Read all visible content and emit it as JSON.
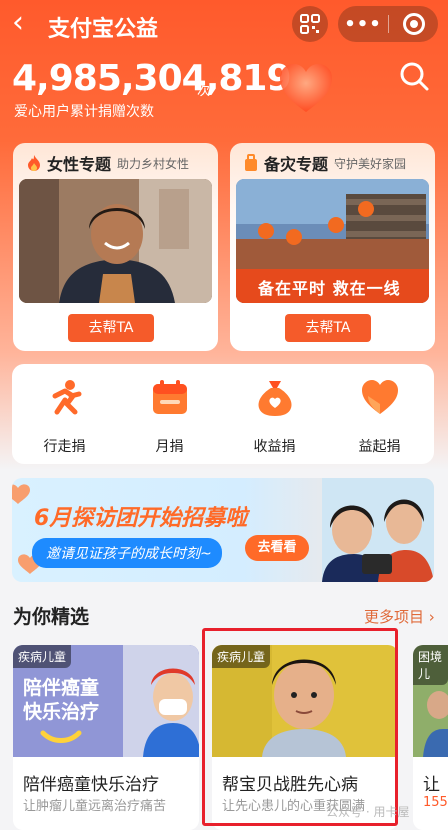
{
  "app": {
    "title": "支付宝公益"
  },
  "stats": {
    "count": "4,985,304,819",
    "unit": "次",
    "label": "爱心用户累计捐赠次数"
  },
  "topics": [
    {
      "title": "女性专题",
      "subtitle": "助力乡村女性",
      "button": "去帮TA"
    },
    {
      "title": "备灾专题",
      "subtitle": "守护美好家园",
      "button": "去帮TA",
      "image_text": "备在平时 救在一线"
    }
  ],
  "quick_actions": [
    {
      "label": "行走捐",
      "icon": "running-icon"
    },
    {
      "label": "月捐",
      "icon": "calendar-icon"
    },
    {
      "label": "收益捐",
      "icon": "money-bag-icon"
    },
    {
      "label": "益起捐",
      "icon": "heart-icon"
    }
  ],
  "banner": {
    "title": "6月探访团开始招募啦",
    "subtitle": "邀请见证孩子的成长时刻~",
    "button": "去看看"
  },
  "section": {
    "title": "为你精选",
    "more": "更多项目"
  },
  "projects": [
    {
      "tag": "疾病儿童",
      "name": "陪伴癌童快乐治疗",
      "desc": "让肿瘤儿童远离治疗痛苦",
      "image_text_1": "陪伴癌童",
      "image_text_2": "快乐治疗"
    },
    {
      "tag": "疾病儿童",
      "name": "帮宝贝战胜先心病",
      "desc": "让先心患儿的心重获圆满"
    },
    {
      "tag": "困境儿",
      "name": "让",
      "desc": "155"
    }
  ],
  "watermark": "公众号 · 用卡屋",
  "colors": {
    "accent": "#f55b2a",
    "highlight_border": "#e8202c"
  }
}
